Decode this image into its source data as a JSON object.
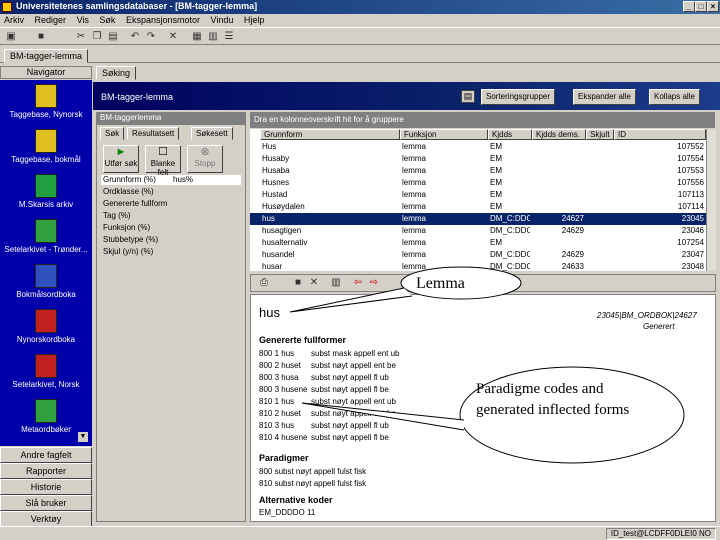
{
  "window": {
    "title": "Universitetenes samlingsdatabaser - [BM-tagger-lemma]",
    "min": "_",
    "max": "□",
    "close": "×"
  },
  "menu": [
    "Arkiv",
    "Rediger",
    "Vis",
    "Søk",
    "Ekspansjonsmotor",
    "Vindu",
    "Hjelp"
  ],
  "doc_tab": "BM-tagger-lemma",
  "nav": {
    "header": "Navigator",
    "items": [
      {
        "label": "Taggebase, Nynorsk",
        "color": "#e0c020",
        "icon": "database-icon"
      },
      {
        "label": "Taggebase, bokmål",
        "color": "#e0c020",
        "icon": "database-icon"
      },
      {
        "label": "M.Skarsis arkiv",
        "color": "#20a040",
        "icon": "book-icon"
      },
      {
        "label": "Setelarkivet - Trønder...",
        "color": "#30a040",
        "icon": "printer-icon"
      },
      {
        "label": "Bokmålsordboka",
        "color": "#3050c0",
        "icon": "book-icon"
      },
      {
        "label": "Nynorskordboka",
        "color": "#c02020",
        "icon": "book-icon"
      },
      {
        "label": "Setelarkivet, Norsk",
        "color": "#c02020",
        "icon": "printer-icon"
      },
      {
        "label": "Metaordbøker",
        "color": "#30a040",
        "icon": "book-icon"
      }
    ],
    "bottom": [
      "Andre fagfelt",
      "Rapporter",
      "Historie",
      "Slå bruker",
      "Verktøy"
    ]
  },
  "subtab": "Søking",
  "panel_title": "BM-tagger-lemma",
  "toolbar_buttons": [
    "Sorteringsgrupper",
    "Ekspander alle",
    "Kollaps alle"
  ],
  "left": {
    "title": "BM-taggerlemma",
    "tabs": [
      "Søk",
      "Resultatsett",
      "Søkesett"
    ],
    "buttons": [
      {
        "label": "Utfør søk",
        "glyph": "►"
      },
      {
        "label": "Blanke felt",
        "glyph": "☐"
      },
      {
        "label": "Stopp",
        "glyph": "⊗"
      }
    ],
    "criteria": [
      {
        "field": "Grunnform (%)",
        "value": "hus%"
      },
      {
        "field": "Ordklasse (%)",
        "value": ""
      },
      {
        "field": "Genererte fullform",
        "value": ""
      },
      {
        "field": "Tag (%)",
        "value": ""
      },
      {
        "field": "Funksjon (%)",
        "value": ""
      },
      {
        "field": "Stubbetype (%)",
        "value": ""
      },
      {
        "field": "Skjul (y/n) (%)",
        "value": ""
      }
    ]
  },
  "grid": {
    "title": "Dra en kolonneoverskrift hit for å gruppere",
    "columns": [
      "Grunnform",
      "Funksjon",
      "Kjdds",
      "Kjdds dems.",
      "Skjult",
      "ID"
    ],
    "rows": [
      [
        "Hus",
        "lemma",
        "EM",
        "",
        "",
        "107552"
      ],
      [
        "Husaby",
        "lemma",
        "EM",
        "",
        "",
        "107554"
      ],
      [
        "Husaba",
        "lemma",
        "EM",
        "",
        "",
        "107553"
      ],
      [
        "Husnes",
        "lemma",
        "EM",
        "",
        "",
        "107556"
      ],
      [
        "Hustad",
        "lemma",
        "EM",
        "",
        "",
        "107113"
      ],
      [
        "Husøydalen",
        "lemma",
        "EM",
        "",
        "",
        "107114"
      ],
      [
        "hus",
        "lemma",
        "DM_C:DDO",
        "24627",
        "",
        "23045"
      ],
      [
        "husagtigen",
        "lemma",
        "DM_C:DDO",
        "24629",
        "",
        "23046"
      ],
      [
        "husalternativ",
        "lemma",
        "EM",
        "",
        "",
        "107254"
      ],
      [
        "husandel",
        "lemma",
        "DM_C:DDO",
        "24629",
        "",
        "23047"
      ],
      [
        "husar",
        "lemma",
        "DM_C:DDO",
        "24633",
        "",
        "23048"
      ]
    ],
    "selected_row": 6
  },
  "detail": {
    "headword": "hus",
    "code": "23045|BM_ORDBOK|24627",
    "status": "Generert",
    "section_forms": "Genererte fullformer",
    "forms": [
      [
        "800 1 hus",
        "subst mask appell ent ub"
      ],
      [
        "800 2 huset",
        "subst nøyt appell ent be"
      ],
      [
        "800 3 husa",
        "subst nøyt appell fl ub"
      ],
      [
        "800 3 husene",
        "subst nøyt appell fl be"
      ],
      [
        "810 1 hus",
        "subst nøyt appell ent ub"
      ],
      [
        "810 2 huset",
        "subst nøyt appell ent be"
      ],
      [
        "810 3 hus",
        "subst nøyt appell fl ub"
      ],
      [
        "810 4 husene",
        "subst nøyt appell fl be"
      ]
    ],
    "section_paradigms": "Paradigmer",
    "paradigms": [
      "800 subst nøyt appell fulst fisk",
      "810 subst nøyt appell fulst fisk"
    ],
    "section_alt": "Alternative koder",
    "alt": "EM_DDDDO 11"
  },
  "status": "ID_test@LCDFF0DLEI0 NO",
  "callouts": {
    "lemma": "Lemma",
    "paradigm": "Paradigme codes and generated inflected forms"
  }
}
